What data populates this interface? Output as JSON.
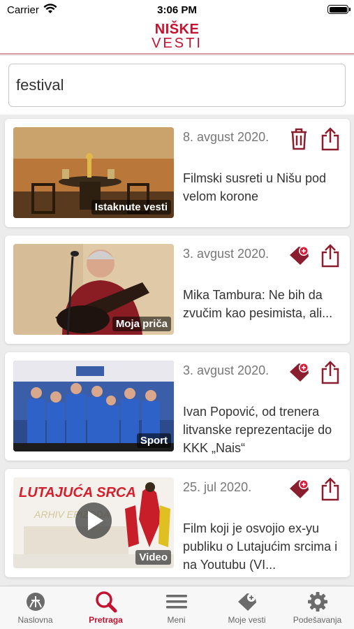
{
  "status_bar": {
    "carrier": "Carrier",
    "time": "3:06 PM"
  },
  "header": {
    "logo_line1": "NIŠKE",
    "logo_line2": "VESTI"
  },
  "search": {
    "value": "festival",
    "placeholder": ""
  },
  "results": [
    {
      "date": "8. avgust 2020.",
      "title": "Filmski susreti u Nišu pod velom korone",
      "category": "Istaknute vesti",
      "action1_icon": "trash-icon",
      "action2_icon": "share-icon"
    },
    {
      "date": "3. avgust 2020.",
      "title": "Mika Tambura: Ne bih da zvučim kao pesimista, ali...",
      "category": "Moja priča",
      "action1_icon": "bookmark-add-icon",
      "action2_icon": "share-icon"
    },
    {
      "date": "3. avgust 2020.",
      "title": "Ivan Popović, od trenera litvanske reprezentacije do KKK „Nais“",
      "category": "Sport",
      "action1_icon": "bookmark-add-icon",
      "action2_icon": "share-icon"
    },
    {
      "date": "25. jul 2020.",
      "title": "Film koji je osvojio ex-yu publiku o Lutajućim srcima i na Youtubu (VI...",
      "category": "Video",
      "action1_icon": "bookmark-add-icon",
      "action2_icon": "share-icon",
      "thumb_text": "LUTAJUĆA SRCA"
    }
  ],
  "tabs": [
    {
      "label": "Naslovna",
      "icon": "home-icon"
    },
    {
      "label": "Pretraga",
      "icon": "search-icon",
      "active": true
    },
    {
      "label": "Meni",
      "icon": "menu-icon"
    },
    {
      "label": "Moje vesti",
      "icon": "bookmark-icon"
    },
    {
      "label": "Podešavanja",
      "icon": "gear-icon"
    }
  ],
  "colors": {
    "brand": "#c41230",
    "action": "#8b1e2e"
  }
}
